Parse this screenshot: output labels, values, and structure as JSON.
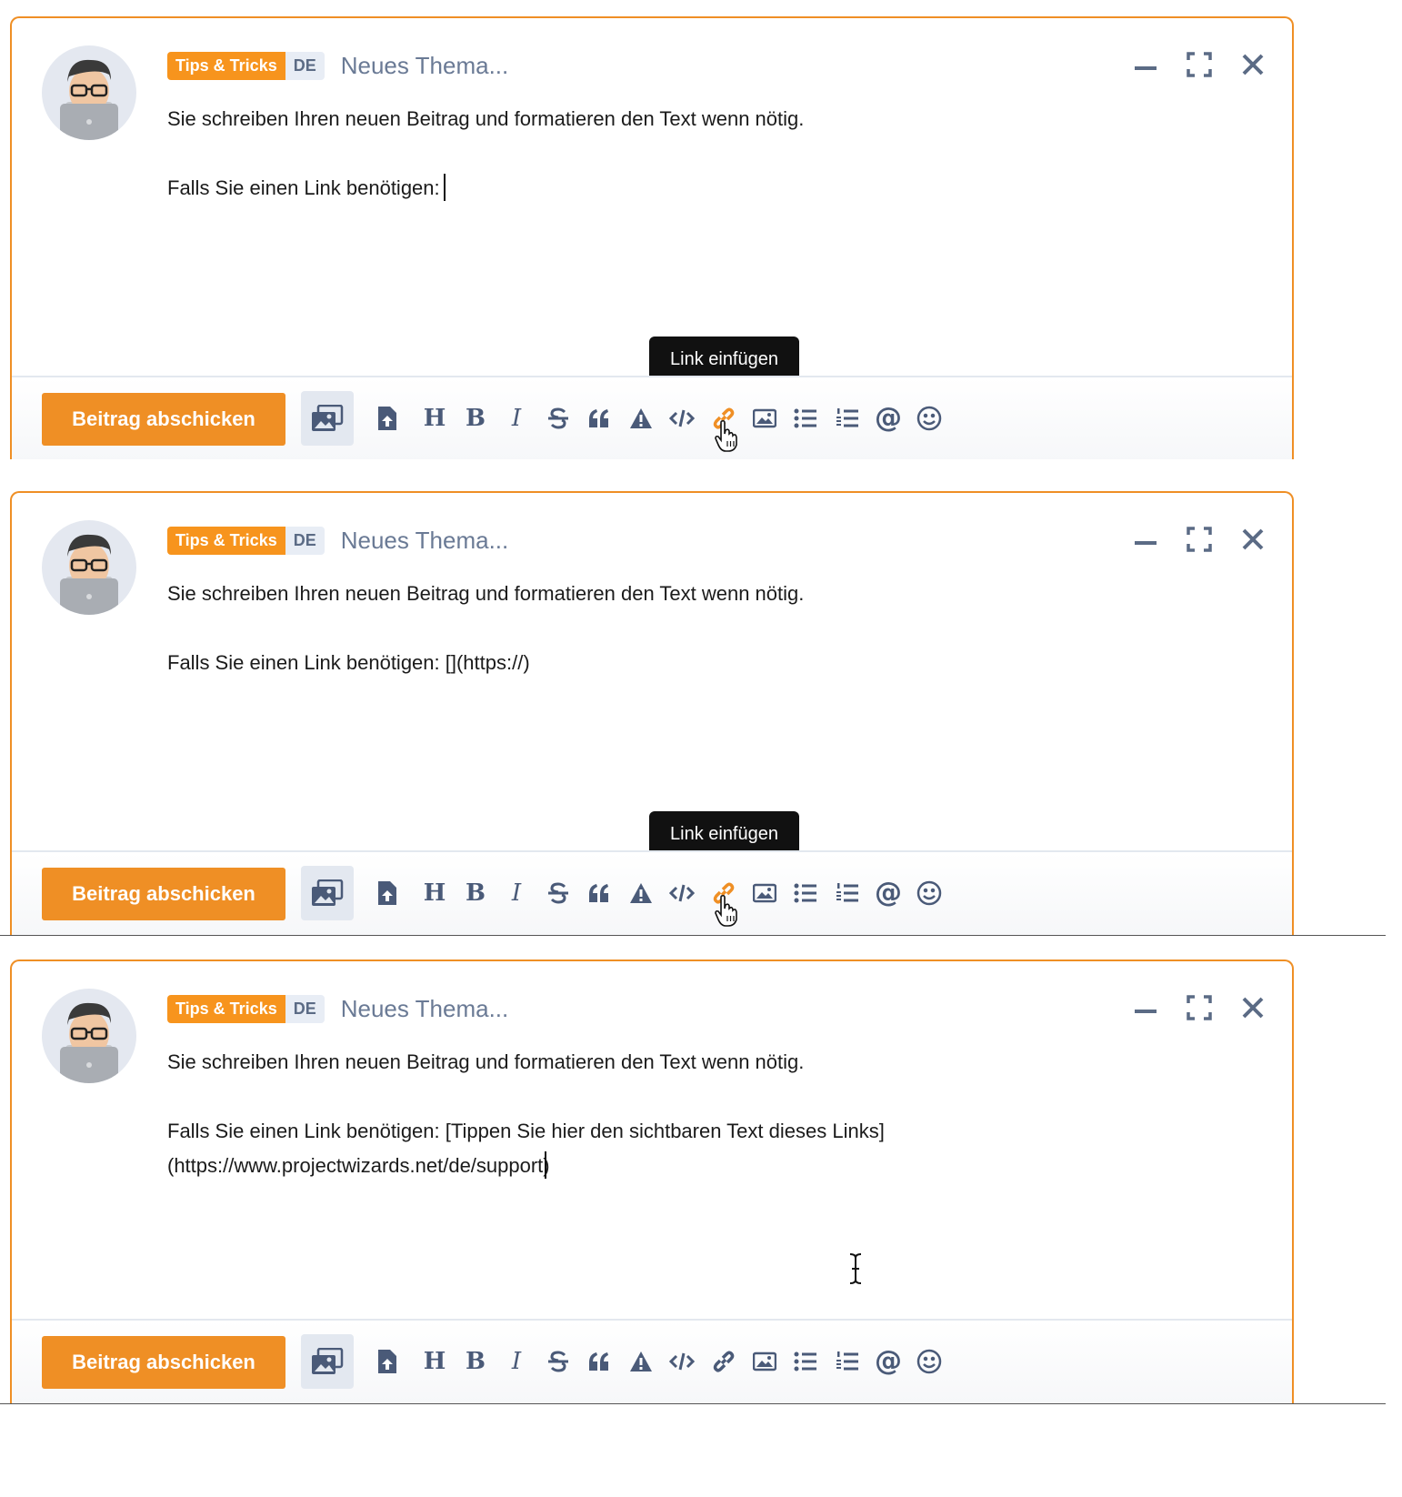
{
  "colors": {
    "accent": "#ef8f25",
    "tag_bg": "#f7941d",
    "icon": "#4a5a78",
    "title": "#6a7a95"
  },
  "composer": {
    "category_tag": "Tips & Tricks",
    "language_tag": "DE",
    "title_placeholder": "Neues Thema...",
    "submit_label": "Beitrag abschicken",
    "tooltip": "Link einfügen",
    "window_controls": [
      "minimize-icon",
      "fullscreen-icon",
      "close-icon"
    ]
  },
  "toolbar": {
    "icons": [
      "upload-icon",
      "heading-icon",
      "bold-icon",
      "italic-icon",
      "strikethrough-icon",
      "quote-icon",
      "warning-icon",
      "code-icon",
      "link-icon",
      "image-icon",
      "bullet-list-icon",
      "numbered-list-icon",
      "mention-icon",
      "emoji-icon"
    ],
    "heading": "H",
    "bold": "B",
    "italic": "I",
    "mention": "@"
  },
  "steps": [
    {
      "line1": "Sie schreiben Ihren neuen Beitrag und formatieren den Text wenn nötig.",
      "line2": "Falls Sie einen Link benötigen:",
      "line3": ""
    },
    {
      "line1": "Sie schreiben Ihren neuen Beitrag und formatieren den Text wenn nötig.",
      "line2": "Falls Sie einen Link benötigen: [](https://)",
      "line3": ""
    },
    {
      "line1": "Sie schreiben Ihren neuen Beitrag und formatieren den Text wenn nötig.",
      "line2": "Falls Sie einen Link benötigen: [Tippen Sie hier den sichtbaren Text dieses Links]",
      "line3": "(https://www.projectwizards.net/de/support)"
    }
  ]
}
